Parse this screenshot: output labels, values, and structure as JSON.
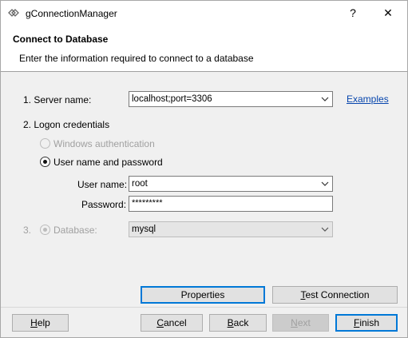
{
  "window": {
    "title": "gConnectionManager",
    "help_glyph": "?",
    "close_glyph": "✕"
  },
  "header": {
    "title": "Connect to Database",
    "subtitle": "Enter the information required to connect to a database"
  },
  "form": {
    "server_label": "1. Server name:",
    "server_value": "localhost;port=3306",
    "examples_link": "Examples",
    "logon_label": "2. Logon credentials",
    "windows_auth_label": "Windows authentication",
    "user_pass_label": "User name and password",
    "username_label": "User name:",
    "username_value": "root",
    "password_label": "Password:",
    "password_value": "*********",
    "database_step": "3.",
    "database_label": "Database:",
    "database_value": "mysql"
  },
  "buttons": {
    "properties": "Properties",
    "test_connection": "Test Connection",
    "help": "Help",
    "cancel": "Cancel",
    "back": "Back",
    "next": "Next",
    "finish": "Finish"
  },
  "icons": {
    "app": "connection-manager-icon",
    "dropdown": "chevron-down-icon"
  }
}
